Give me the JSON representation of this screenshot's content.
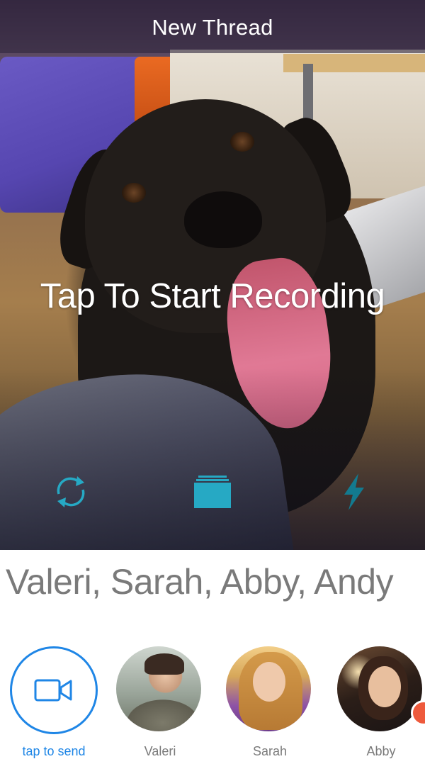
{
  "header": {
    "title": "New Thread"
  },
  "camera": {
    "prompt": "Tap To Start Recording",
    "icons": {
      "rotate": "camera-rotate-icon",
      "gallery": "gallery-icon",
      "flash": "flash-icon"
    },
    "icon_color": "#26a9c4"
  },
  "recipients": {
    "label": "Valeri, Sarah, Abby, Andy"
  },
  "contacts": [
    {
      "name": "tap to send",
      "kind": "send",
      "icon": "video-camera-icon",
      "accent": "#1f86e6"
    },
    {
      "name": "Valeri",
      "kind": "avatar"
    },
    {
      "name": "Sarah",
      "kind": "avatar"
    },
    {
      "name": "Abby",
      "kind": "avatar",
      "online": true,
      "status_color": "#ee5a3c"
    }
  ]
}
